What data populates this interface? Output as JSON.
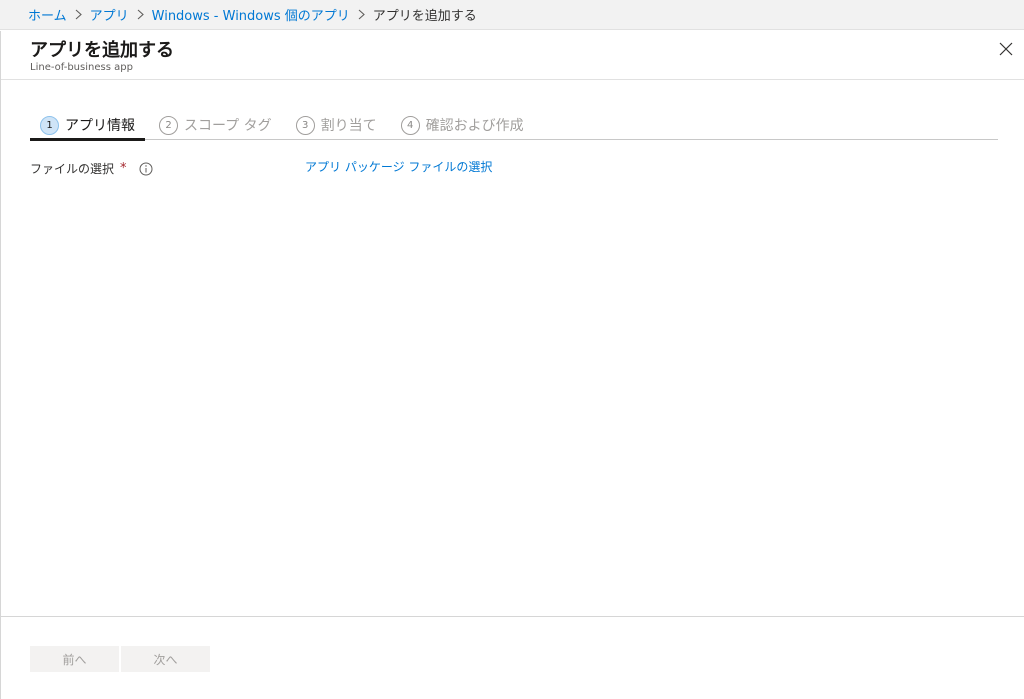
{
  "breadcrumb": {
    "items": [
      {
        "label": "ホーム"
      },
      {
        "label": "アプリ"
      },
      {
        "label": "Windows - Windows 個のアプリ"
      },
      {
        "label": "アプリを追加する"
      }
    ]
  },
  "blade": {
    "title": "アプリを追加する",
    "subtitle": "Line-of-business app",
    "close_icon": "close-icon"
  },
  "wizard": {
    "steps": [
      {
        "number": "1",
        "label": "アプリ情報",
        "active": true
      },
      {
        "number": "2",
        "label": "スコープ タグ",
        "active": false
      },
      {
        "number": "3",
        "label": "割り当て",
        "active": false
      },
      {
        "number": "4",
        "label": "確認および作成",
        "active": false
      }
    ]
  },
  "form": {
    "file_label": "ファイルの選択",
    "required_mark": "*",
    "info_icon": "info-icon",
    "file_link": "アプリ パッケージ ファイルの選択"
  },
  "footer": {
    "prev_label": "前へ",
    "next_label": "次へ"
  },
  "colors": {
    "accent": "#0078d4",
    "required": "#a4262c",
    "disabled_text": "#a19f9d"
  }
}
